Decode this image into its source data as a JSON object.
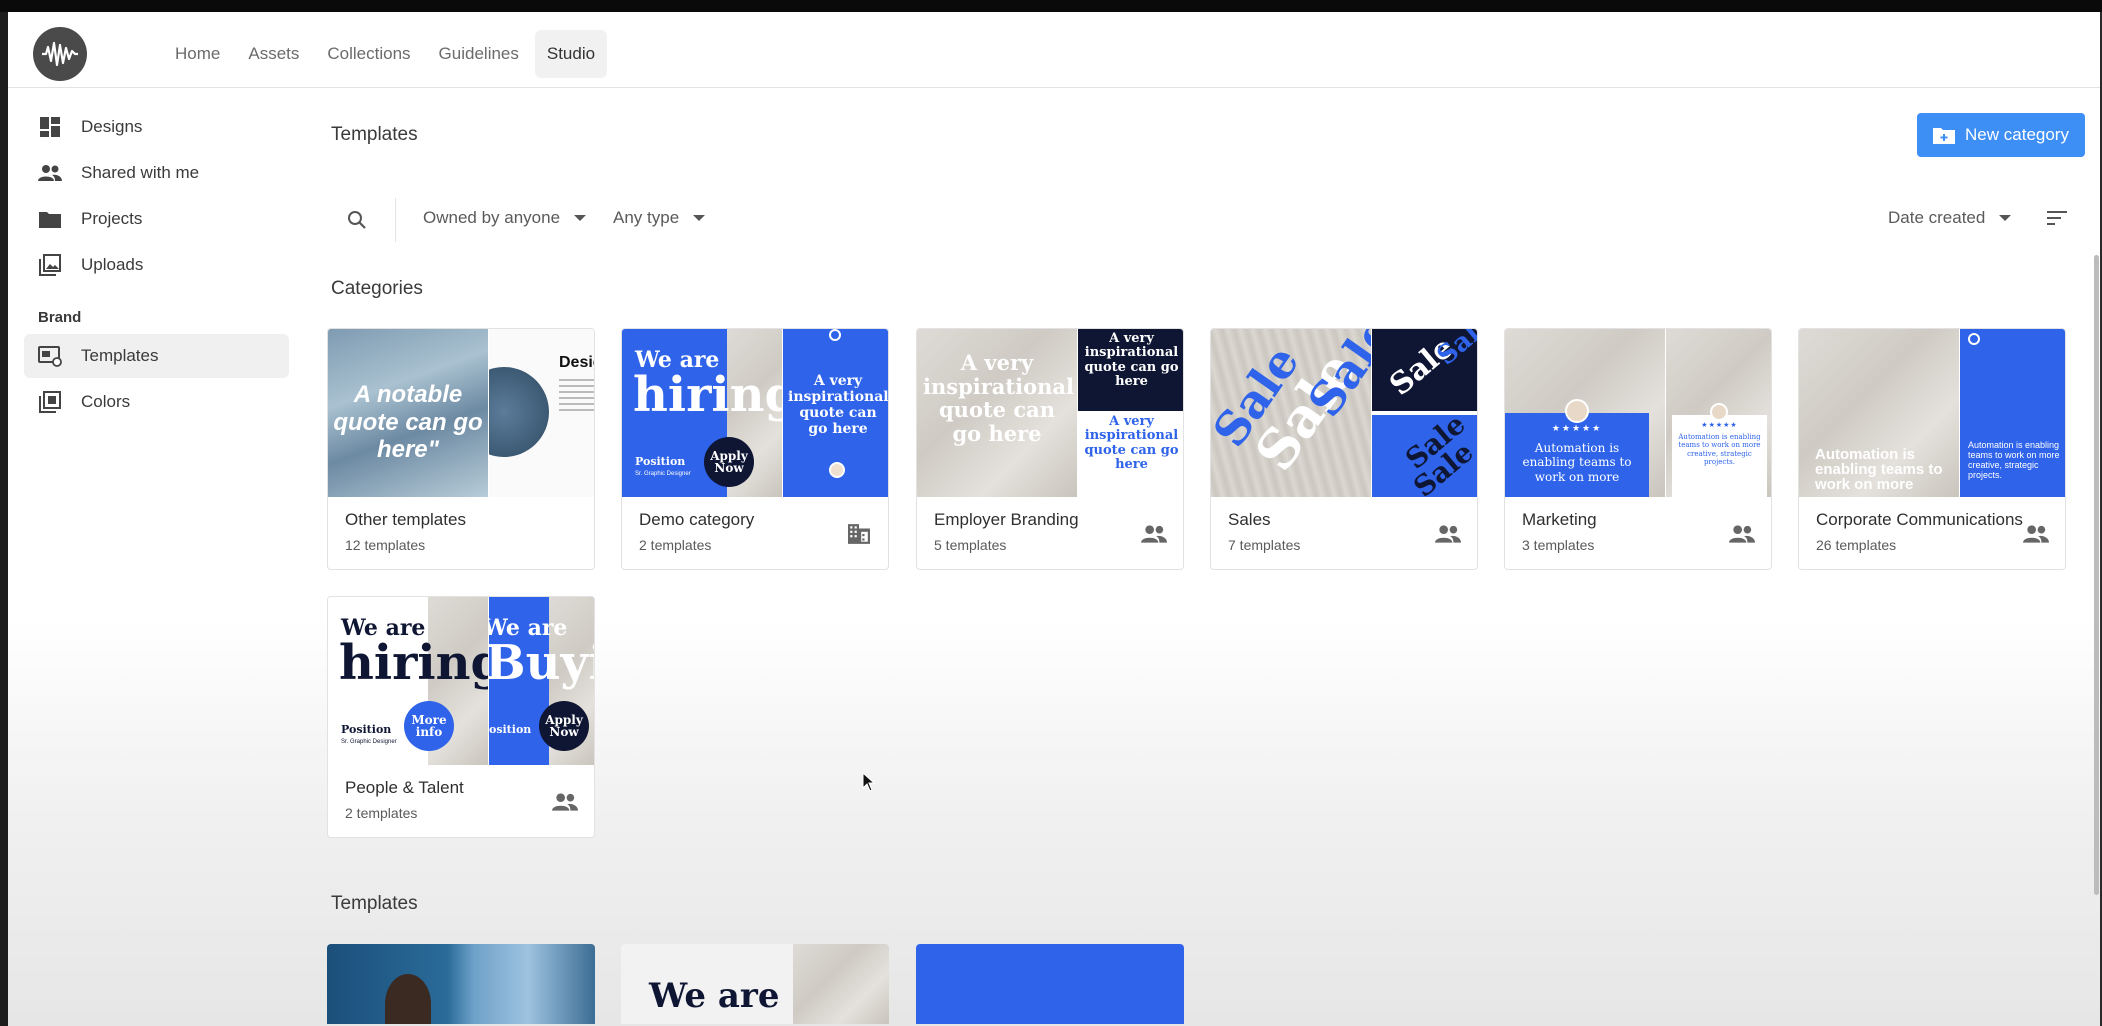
{
  "nav": {
    "items": [
      "Home",
      "Assets",
      "Collections",
      "Guidelines",
      "Studio"
    ],
    "active": "Studio"
  },
  "sidebar": {
    "items": [
      {
        "label": "Designs",
        "icon": "dashboard-icon"
      },
      {
        "label": "Shared with me",
        "icon": "people-icon"
      },
      {
        "label": "Projects",
        "icon": "folder-icon"
      },
      {
        "label": "Uploads",
        "icon": "photo-library-icon"
      }
    ],
    "section_label": "Brand",
    "brand_items": [
      {
        "label": "Templates",
        "icon": "templates-icon",
        "active": true
      },
      {
        "label": "Colors",
        "icon": "palette-icon"
      }
    ]
  },
  "page": {
    "title": "Templates",
    "new_category_label": "New category"
  },
  "filters": {
    "owner": "Owned by anyone",
    "type": "Any type",
    "sort": "Date created"
  },
  "categories": {
    "title": "Categories",
    "items": [
      {
        "name": "Other templates",
        "count": "12 templates",
        "icon": ""
      },
      {
        "name": "Demo category",
        "count": "2 templates",
        "icon": "business-icon"
      },
      {
        "name": "Employer Branding",
        "count": "5 templates",
        "icon": "people-icon"
      },
      {
        "name": "Sales",
        "count": "7 templates",
        "icon": "people-icon"
      },
      {
        "name": "Marketing",
        "count": "3 templates",
        "icon": "people-icon"
      },
      {
        "name": "Corporate Communications",
        "count": "26 templates",
        "icon": "people-icon"
      },
      {
        "name": "People & Talent",
        "count": "2 templates",
        "icon": "people-icon"
      }
    ]
  },
  "thumb_text": {
    "notable_quote": "A notable quote can go here\"",
    "design": "Desig",
    "we_are": "We are",
    "hiring": "hiring",
    "buyi": "Buyi",
    "position": "Position",
    "role": "Sr. Graphic Designer",
    "apply_now": "Apply Now",
    "more_info": "More info",
    "inspirational": "A very inspirational quote can go here",
    "sale": "Sale",
    "automation": "Automation is enabling teams to work on more",
    "automation_long": "Automation is enabling teams to work on more creative, strategic projects.",
    "stars": "★★★★★"
  },
  "templates": {
    "title": "Templates",
    "preview_text": "We are"
  },
  "colors": {
    "accent": "#3d8ef5",
    "brand_blue": "#2e63ea",
    "navy": "#0f1633"
  }
}
